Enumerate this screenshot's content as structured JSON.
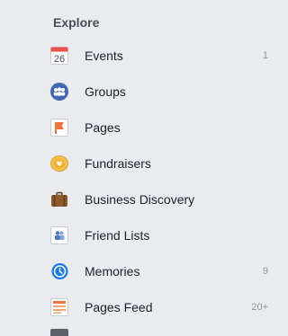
{
  "explore": {
    "title": "Explore",
    "items": [
      {
        "label": "Events",
        "count": "1",
        "icon": "calendar-icon"
      },
      {
        "label": "Groups",
        "count": "",
        "icon": "groups-icon"
      },
      {
        "label": "Pages",
        "count": "",
        "icon": "flag-icon"
      },
      {
        "label": "Fundraisers",
        "count": "",
        "icon": "heart-coin-icon"
      },
      {
        "label": "Business Discovery",
        "count": "",
        "icon": "briefcase-icon"
      },
      {
        "label": "Friend Lists",
        "count": "",
        "icon": "friend-list-icon"
      },
      {
        "label": "Memories",
        "count": "9",
        "icon": "clock-rewind-icon"
      },
      {
        "label": "Pages Feed",
        "count": "20+",
        "icon": "pages-feed-icon"
      }
    ],
    "calendar_day": "26"
  },
  "colors": {
    "background": "#e9ebee",
    "groups_blue": "#4267b2",
    "memories_blue": "#1877f2",
    "flag_orange": "#f2743c",
    "fundraiser_gold": "#f7c24a",
    "briefcase_brown": "#8d5a2d",
    "events_red": "#e9524a"
  }
}
